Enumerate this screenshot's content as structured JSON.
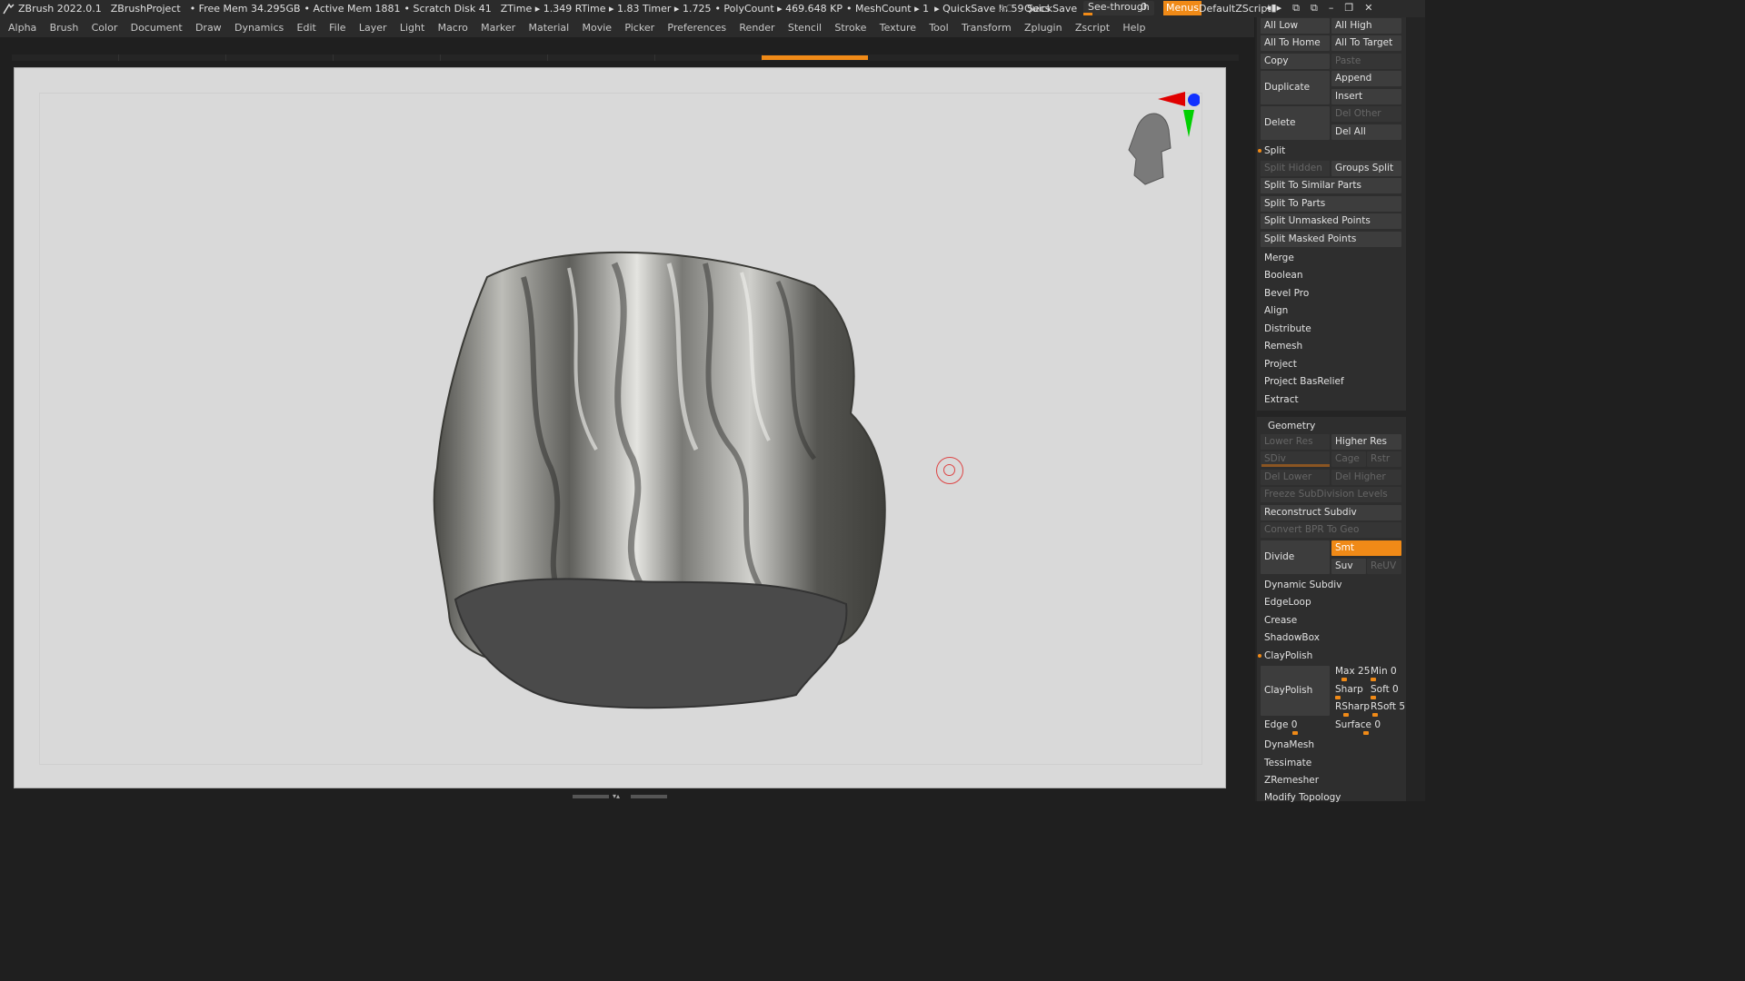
{
  "title_bar": {
    "app": "ZBrush 2022.0.1",
    "project": "ZBrushProject",
    "free_mem": "• Free Mem 34.295GB",
    "active_mem": "• Active Mem 1881",
    "scratch": "• Scratch Disk 41",
    "ztime": "ZTime ▸ 1.349 RTime ▸ 1.83 Timer ▸ 1.725",
    "polycount": "• PolyCount ▸ 469.648 KP",
    "meshcount": "• MeshCount ▸ 1",
    "quicksave_timer": "▸ QuickSave In 59 Secs",
    "ac": "AC",
    "quicksave": "QuickSave",
    "seethrough": "See-through",
    "seethrough_value": "0",
    "menus": "Menus",
    "default_zscript": "DefaultZScript"
  },
  "menubar": [
    "Alpha",
    "Brush",
    "Color",
    "Document",
    "Draw",
    "Dynamics",
    "Edit",
    "File",
    "Layer",
    "Light",
    "Macro",
    "Marker",
    "Material",
    "Movie",
    "Picker",
    "Preferences",
    "Render",
    "Stencil",
    "Stroke",
    "Texture",
    "Tool",
    "Transform",
    "Zplugin",
    "Zscript",
    "Help"
  ],
  "subtool": {
    "all_low": "All Low",
    "all_high": "All High",
    "all_to_home": "All To Home",
    "all_to_target": "All To Target",
    "copy": "Copy",
    "paste": "Paste",
    "duplicate": "Duplicate",
    "append": "Append",
    "insert": "Insert",
    "delete": "Delete",
    "del_other": "Del Other",
    "del_all": "Del All",
    "split": "Split",
    "split_hidden": "Split Hidden",
    "groups_split": "Groups Split",
    "split_similar": "Split To Similar Parts",
    "split_parts": "Split To Parts",
    "split_unmasked": "Split Unmasked Points",
    "split_masked": "Split Masked Points",
    "items": [
      "Merge",
      "Boolean",
      "Bevel Pro",
      "Align",
      "Distribute",
      "Remesh",
      "Project",
      "Project BasRelief",
      "Extract"
    ]
  },
  "geometry": {
    "header": "Geometry",
    "lower_res": "Lower Res",
    "higher_res": "Higher Res",
    "sdiv": "SDiv",
    "cage": "Cage",
    "rstr": "Rstr",
    "del_lower": "Del Lower",
    "del_higher": "Del Higher",
    "freeze": "Freeze SubDivision Levels",
    "reconstruct": "Reconstruct Subdiv",
    "convert_bpr": "Convert BPR To Geo",
    "divide": "Divide",
    "smt": "Smt",
    "suv": "Suv",
    "reuv": "ReUV",
    "dynamic_subdiv": "Dynamic Subdiv",
    "edgeloop": "EdgeLoop",
    "crease": "Crease",
    "shadowbox": "ShadowBox",
    "claypolish_header": "ClayPolish",
    "claypolish_btn": "ClayPolish",
    "max": "Max 25",
    "min": "Min 0",
    "sharp": "Sharp",
    "soft": "Soft 0",
    "rsharp": "RSharp",
    "rsoft": "RSoft 5",
    "edge": "Edge 0",
    "surface": "Surface 0",
    "dynamesh": "DynaMesh",
    "tessimate": "Tessimate",
    "zremesher": "ZRemesher",
    "modify_topology": "Modify Topology"
  },
  "colors": {
    "accent": "#f08a17",
    "panel": "#242424",
    "button": "#3d3d3d",
    "canvas": "#d9d9d9"
  },
  "icons": [
    "zbrush-logo-icon",
    "orientation-head-icon",
    "axis-gizmo-icon",
    "brush-cursor-icon"
  ]
}
